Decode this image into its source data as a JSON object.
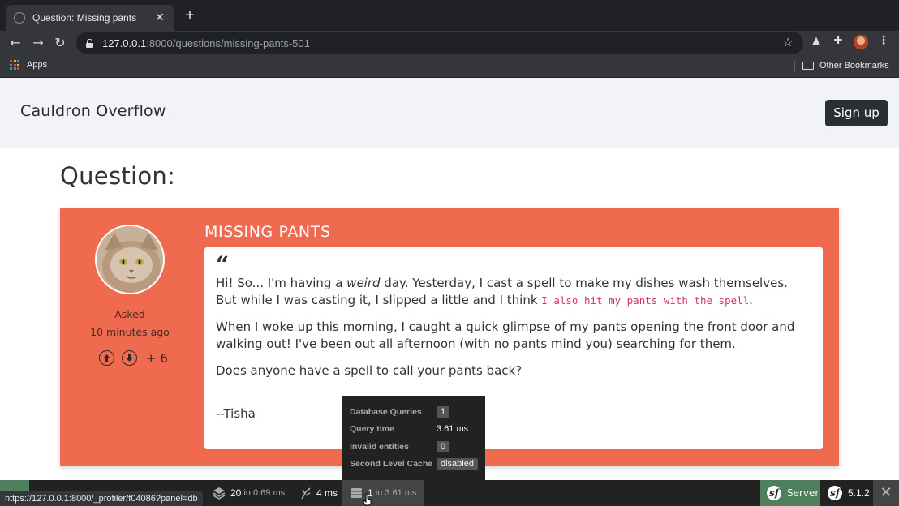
{
  "browser": {
    "tab_title": "Question: Missing pants",
    "url_host": "127.0.0.1",
    "url_rest": ":8000/questions/missing-pants-501",
    "bookmarks": {
      "apps_label": "Apps",
      "other_label": "Other Bookmarks"
    },
    "status_url": "https://127.0.0.1:8000/_profiler/f04086?panel=db"
  },
  "site": {
    "brand": "Cauldron Overflow",
    "signup_label": "Sign up"
  },
  "page": {
    "heading": "Question:"
  },
  "question": {
    "title": "MISSING PANTS",
    "asked_label": "Asked",
    "asked_time": "10 minutes ago",
    "vote_count": "+ 6",
    "p1_a": "Hi! So... I'm having a ",
    "p1_em": "weird",
    "p1_b": " day. Yesterday, I cast a spell to make my dishes wash themselves. But while I was casting it, I slipped a little and I think ",
    "p1_code": "I also hit my pants with the spell",
    "p1_c": ".",
    "p2": "When I woke up this morning, I caught a quick glimpse of my pants opening the front door and walking out! I've been out all afternoon (with no pants mind you) searching for them.",
    "p3": "Does anyone have a spell to call your pants back?",
    "signature": "--Tisha"
  },
  "db_panel": {
    "rows": [
      {
        "key": "Database Queries",
        "value": "1"
      },
      {
        "key": "Query time",
        "value": "3.61 ms"
      },
      {
        "key": "Invalid entities",
        "value": "0"
      },
      {
        "key": "Second Level Cache",
        "value": "disabled"
      }
    ]
  },
  "debug_toolbar": {
    "forms_count": "20",
    "forms_time": "in 0.69 ms",
    "logs_time": "4 ms",
    "db_count": "1",
    "db_time": "in 3.61 ms",
    "server_label": "Server",
    "symfony_version": "5.1.2"
  },
  "colors": {
    "card": "#ef6a4f",
    "toolbar_bg": "#222222",
    "toolbar_accent": "#4f805d",
    "code_text": "#d6336c"
  }
}
